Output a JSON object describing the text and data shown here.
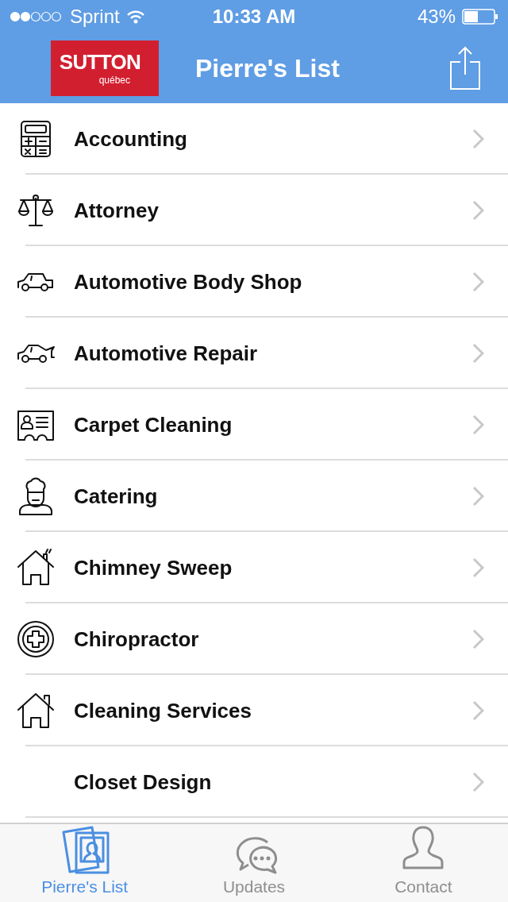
{
  "status_bar": {
    "carrier": "Sprint",
    "time": "10:33 AM",
    "battery": "43%"
  },
  "nav": {
    "logo": {
      "name": "SUTTON",
      "region": "québec"
    },
    "title": "Pierre's List"
  },
  "items": [
    {
      "label": "Accounting",
      "kind": "calculator"
    },
    {
      "label": "Attorney",
      "kind": "scales"
    },
    {
      "label": "Automotive Body Shop",
      "kind": "car"
    },
    {
      "label": "Automotive Repair",
      "kind": "car-open"
    },
    {
      "label": "Carpet Cleaning",
      "kind": "id-card"
    },
    {
      "label": "Catering",
      "kind": "chef"
    },
    {
      "label": "Chimney Sweep",
      "kind": "house-smoke"
    },
    {
      "label": "Chiropractor",
      "kind": "medical"
    },
    {
      "label": "Cleaning Services",
      "kind": "house"
    },
    {
      "label": "Closet Design",
      "kind": "plain"
    }
  ],
  "tabs": [
    {
      "label": "Pierre's List",
      "kind": "photos",
      "selected": true
    },
    {
      "label": "Updates",
      "kind": "chat",
      "selected": false
    },
    {
      "label": "Contact",
      "kind": "person",
      "selected": false
    }
  ]
}
